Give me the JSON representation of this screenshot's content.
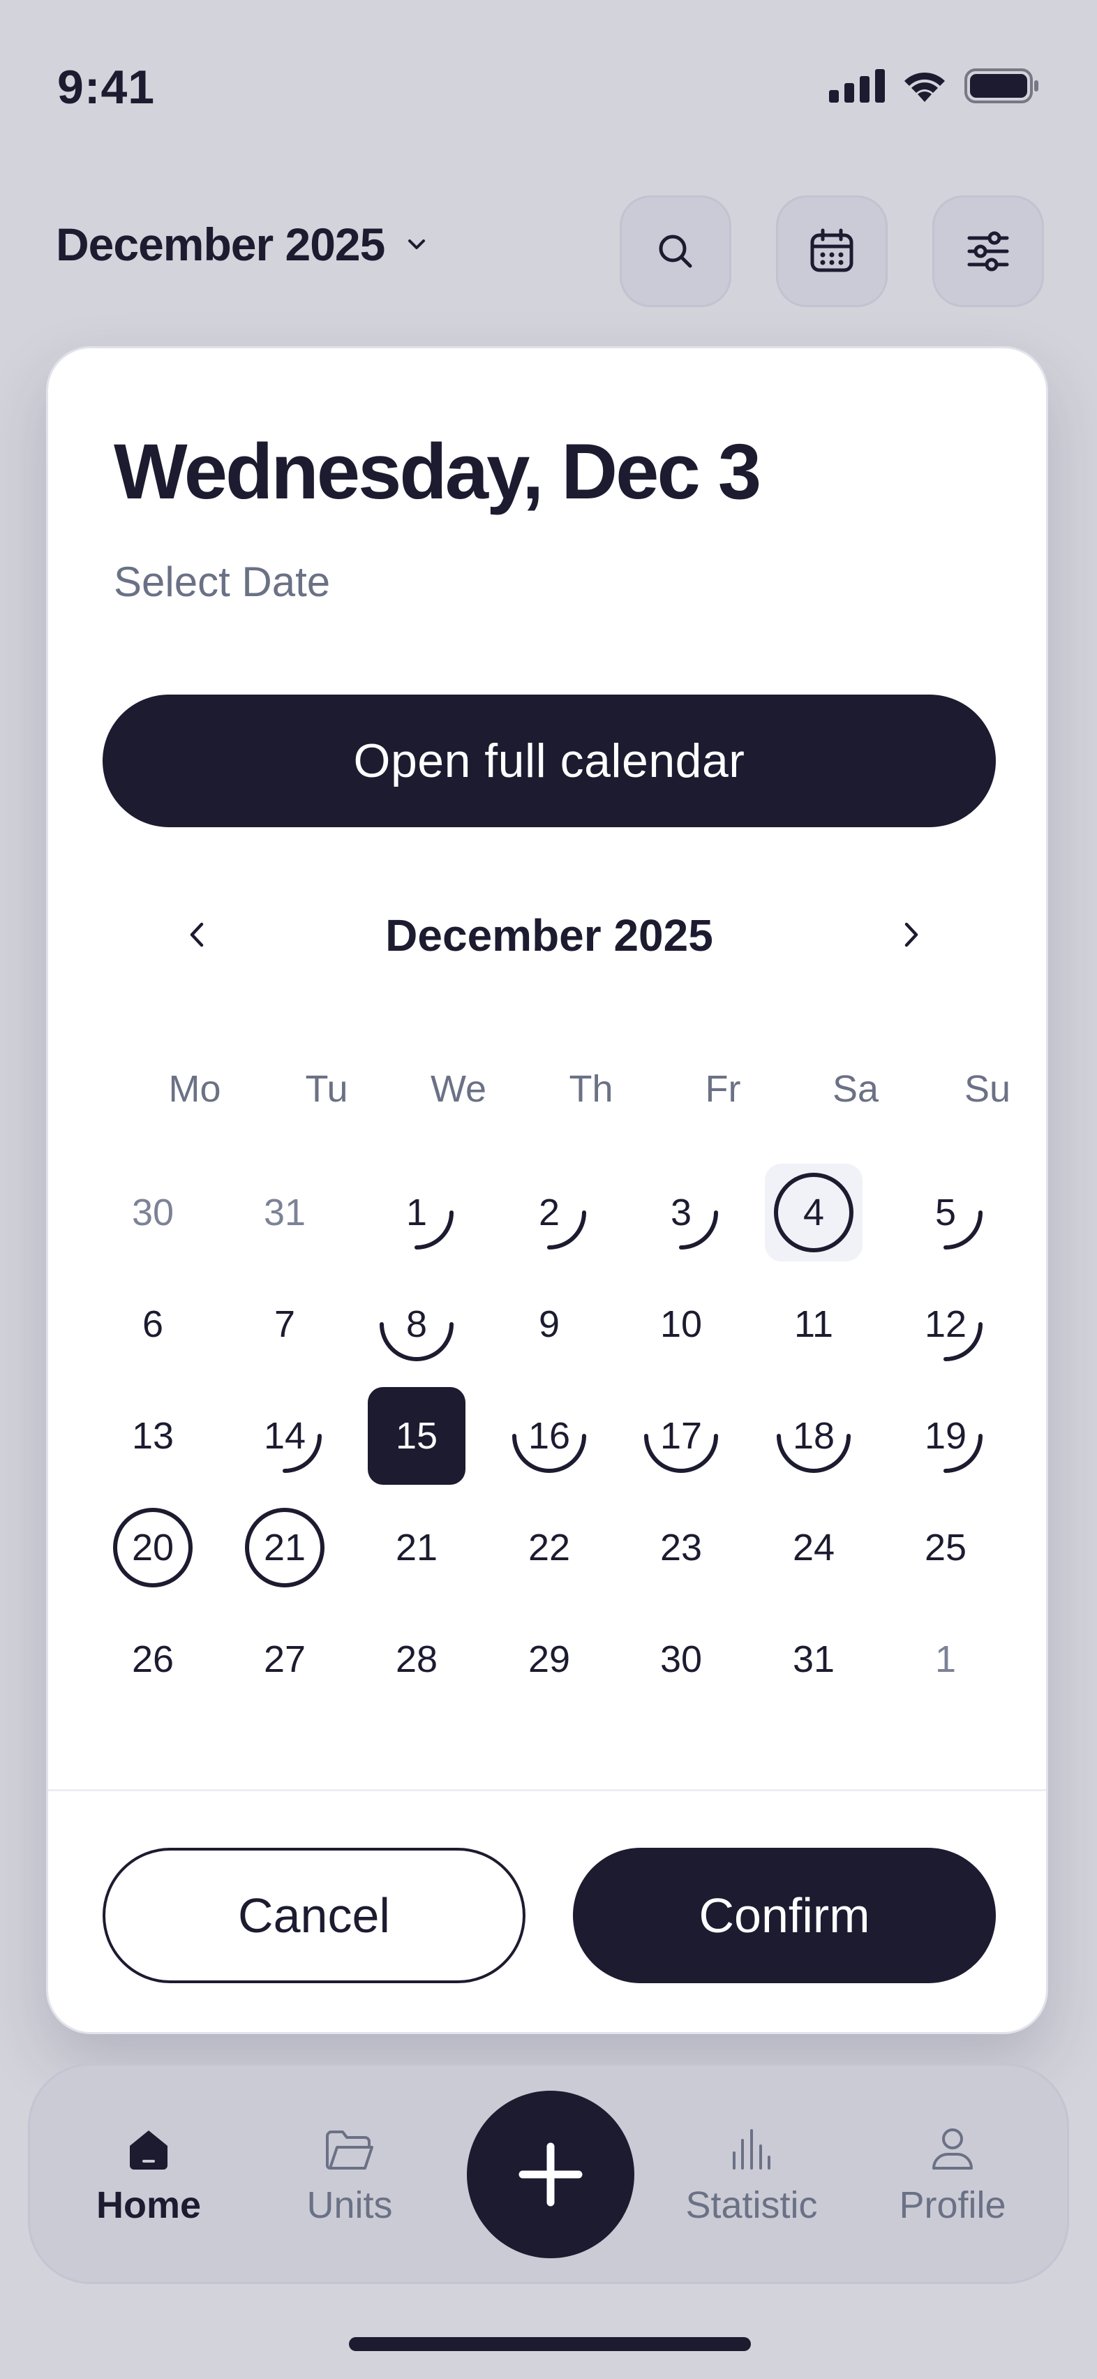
{
  "status_bar": {
    "time": "9:41"
  },
  "header": {
    "month_label": "December 2025",
    "icons": [
      "search-icon",
      "calendar-icon",
      "sliders-icon"
    ]
  },
  "modal": {
    "title": "Wednesday, Dec 3",
    "subtitle": "Select Date",
    "open_full_calendar_label": "Open full calendar",
    "calendar": {
      "month_label": "December 2025",
      "weekdays": [
        "Mo",
        "Tu",
        "We",
        "Th",
        "Fr",
        "Sa",
        "Su"
      ],
      "weeks": [
        [
          {
            "label": "30",
            "muted": true
          },
          {
            "label": "31",
            "muted": true
          },
          {
            "label": "1",
            "mark": "quarter"
          },
          {
            "label": "2",
            "mark": "quarter"
          },
          {
            "label": "3",
            "mark": "quarter"
          },
          {
            "label": "4",
            "mark": "full",
            "today": true
          },
          {
            "label": "5",
            "mark": "quarter"
          }
        ],
        [
          {
            "label": "6"
          },
          {
            "label": "7"
          },
          {
            "label": "8",
            "mark": "half"
          },
          {
            "label": "9"
          },
          {
            "label": "10"
          },
          {
            "label": "11"
          },
          {
            "label": "12",
            "mark": "quarter"
          }
        ],
        [
          {
            "label": "13"
          },
          {
            "label": "14",
            "mark": "quarter"
          },
          {
            "label": "15",
            "selected": true
          },
          {
            "label": "16",
            "mark": "half"
          },
          {
            "label": "17",
            "mark": "half"
          },
          {
            "label": "18",
            "mark": "half"
          },
          {
            "label": "19",
            "mark": "quarter"
          }
        ],
        [
          {
            "label": "20",
            "mark": "full"
          },
          {
            "label": "21",
            "mark": "full"
          },
          {
            "label": "21"
          },
          {
            "label": "22"
          },
          {
            "label": "23"
          },
          {
            "label": "24"
          },
          {
            "label": "25"
          }
        ],
        [
          {
            "label": "26"
          },
          {
            "label": "27"
          },
          {
            "label": "28"
          },
          {
            "label": "29"
          },
          {
            "label": "30"
          },
          {
            "label": "31"
          },
          {
            "label": "1",
            "muted": true
          }
        ]
      ]
    },
    "cancel_label": "Cancel",
    "confirm_label": "Confirm"
  },
  "tabbar": {
    "home_label": "Home",
    "units_label": "Units",
    "statistic_label": "Statistic",
    "profile_label": "Profile",
    "active": "Home"
  },
  "colors": {
    "background": "#d3d3db",
    "primary": "#1c1b30",
    "muted_text": "#6b7185",
    "card": "#ffffff"
  }
}
